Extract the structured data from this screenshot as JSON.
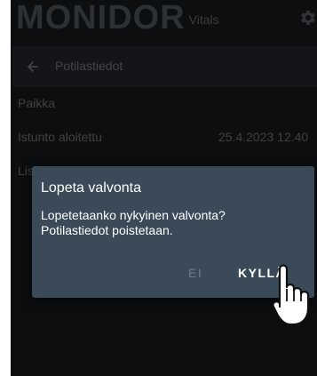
{
  "app": {
    "brand_main": "MONIDOR",
    "brand_sub": "Vitals",
    "settings_icon": "gear-icon"
  },
  "header": {
    "back_icon": "arrow-left-icon",
    "title": "Potilastiedot"
  },
  "details": {
    "place_label": "Paikka",
    "session_label": "Istunto aloitettu",
    "session_value": "25.4.2023 12.40",
    "additional_label_partial": "Lis"
  },
  "dialog": {
    "title": "Lopeta valvonta",
    "message_line1": "Lopetetaanko nykyinen valvonta?",
    "message_line2": "Potilastiedot poistetaan.",
    "no_label": "EI",
    "yes_label": "KYLLÄ"
  },
  "overlay": {
    "pointer_icon": "hand-pointer-icon"
  },
  "colors": {
    "background": "#1b1d20",
    "header_bar": "#272b31",
    "dialog_bg": "#3b4a58",
    "text_muted": "#7b838b"
  }
}
